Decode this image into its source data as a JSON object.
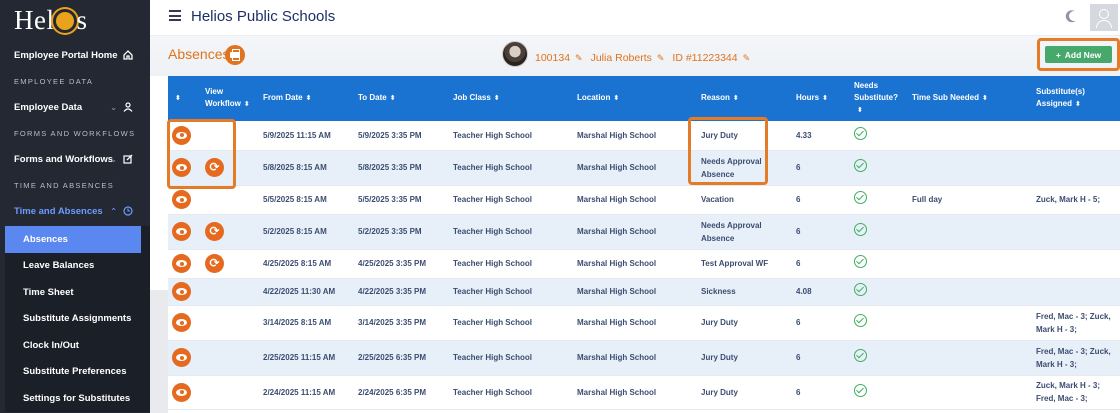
{
  "sidebar": {
    "logo": {
      "text_left": "Hel",
      "text_right": "s"
    },
    "portal_home": "Employee Portal Home",
    "section_employee_data": "EMPLOYEE DATA",
    "employee_data": "Employee Data",
    "section_forms": "FORMS AND WORKFLOWS",
    "forms_workflows": "Forms and Workflows",
    "section_time": "TIME AND ABSENCES",
    "time_absences": "Time and Absences",
    "sub_items": [
      "Absences",
      "Leave Balances",
      "Time Sheet",
      "Substitute Assignments",
      "Clock In/Out",
      "Substitute Preferences",
      "Settings for Substitutes"
    ]
  },
  "topbar": {
    "title": "Helios Public Schools"
  },
  "header": {
    "page_title": "Absences",
    "employee_number": "100134",
    "employee_name": "Julia Roberts",
    "employee_id": "ID #11223344",
    "add_new": "Add New"
  },
  "table": {
    "columns": [
      "",
      "View Workflow",
      "From Date",
      "To Date",
      "Job Class",
      "Location",
      "Reason",
      "Hours",
      "Needs Substitute?",
      "Time Sub Needed",
      "Substitute(s) Assigned"
    ],
    "rows": [
      {
        "workflow": false,
        "from": "5/9/2025 11:15 AM",
        "to": "5/9/2025 3:35 PM",
        "job": "Teacher High School",
        "loc": "Marshal High School",
        "reason": "Jury Duty",
        "hours": "4.33",
        "sub_needed": "",
        "assigned": ""
      },
      {
        "workflow": true,
        "from": "5/8/2025 8:15 AM",
        "to": "5/8/2025 3:35 PM",
        "job": "Teacher High School",
        "loc": "Marshal High School",
        "reason": "Needs Approval Absence",
        "hours": "6",
        "sub_needed": "",
        "assigned": ""
      },
      {
        "workflow": false,
        "from": "5/5/2025 8:15 AM",
        "to": "5/5/2025 3:35 PM",
        "job": "Teacher High School",
        "loc": "Marshal High School",
        "reason": "Vacation",
        "hours": "6",
        "sub_needed": "Full day",
        "assigned": "Zuck, Mark H - 5;"
      },
      {
        "workflow": true,
        "from": "5/2/2025 8:15 AM",
        "to": "5/2/2025 3:35 PM",
        "job": "Teacher High School",
        "loc": "Marshal High School",
        "reason": "Needs Approval Absence",
        "hours": "6",
        "sub_needed": "",
        "assigned": ""
      },
      {
        "workflow": true,
        "from": "4/25/2025 8:15 AM",
        "to": "4/25/2025 3:35 PM",
        "job": "Teacher High School",
        "loc": "Marshal High School",
        "reason": "Test Approval WF",
        "hours": "6",
        "sub_needed": "",
        "assigned": ""
      },
      {
        "workflow": false,
        "from": "4/22/2025 11:30 AM",
        "to": "4/22/2025 3:35 PM",
        "job": "Teacher High School",
        "loc": "Marshal High School",
        "reason": "Sickness",
        "hours": "4.08",
        "sub_needed": "",
        "assigned": ""
      },
      {
        "workflow": false,
        "from": "3/14/2025 8:15 AM",
        "to": "3/14/2025 3:35 PM",
        "job": "Teacher High School",
        "loc": "Marshal High School",
        "reason": "Jury Duty",
        "hours": "6",
        "sub_needed": "",
        "assigned": "Fred, Mac - 3; Zuck, Mark H - 3;"
      },
      {
        "workflow": false,
        "from": "2/25/2025 11:15 AM",
        "to": "2/25/2025 6:35 PM",
        "job": "Teacher High School",
        "loc": "Marshal High School",
        "reason": "Jury Duty",
        "hours": "6",
        "sub_needed": "",
        "assigned": "Fred, Mac - 3; Zuck, Mark H - 3;"
      },
      {
        "workflow": false,
        "from": "2/24/2025 11:15 AM",
        "to": "2/24/2025 6:35 PM",
        "job": "Teacher High School",
        "loc": "Marshal High School",
        "reason": "Jury Duty",
        "hours": "6",
        "sub_needed": "",
        "assigned": "Zuck, Mark H - 3; Fred, Mac - 3;"
      }
    ]
  },
  "colors": {
    "accent": "#e0731e",
    "header_blue": "#1a73d0",
    "sidebar": "#232833",
    "selected": "#5b87f0",
    "success": "#46a86a"
  }
}
